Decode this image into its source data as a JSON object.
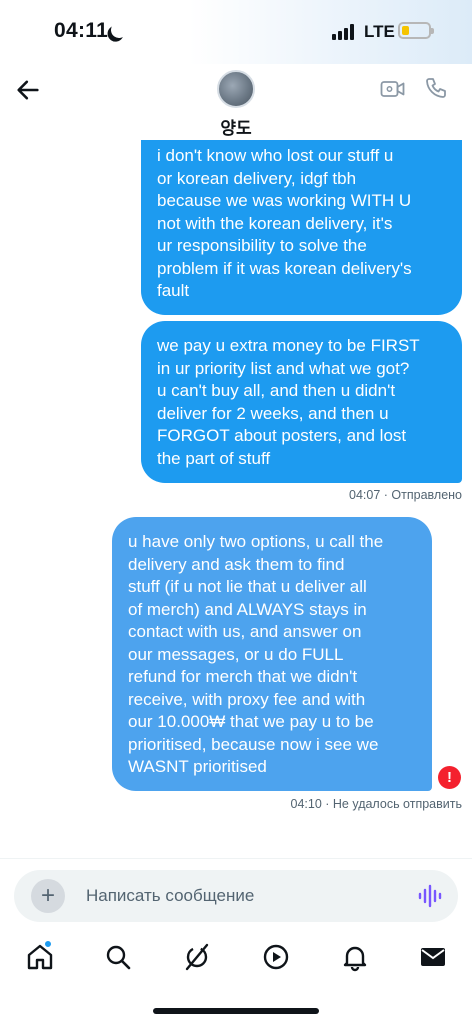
{
  "status_bar": {
    "time": "04:11",
    "network": "LTE",
    "battery_level": 0.2,
    "battery_color": "#f5c400"
  },
  "header": {
    "contact_name": "양도",
    "back_icon": "arrow-left-icon",
    "video_icon": "video-call-icon",
    "phone_icon": "phone-icon"
  },
  "messages": [
    {
      "text": "i don't know who lost our stuff u\nor korean delivery, idgf tbh\nbecause we was working WITH U\nnot with the korean delivery, it's\nur responsibility to solve the\nproblem if it was korean delivery's\nfault"
    },
    {
      "text": "we pay u extra money to be FIRST\nin ur priority list and what we got?\nu can't buy all, and then u didn't\ndeliver for 2 weeks, and then u\nFORGOT about posters, and lost\nthe part of stuff",
      "meta": "04:07 · Отправлено"
    },
    {
      "text": "u have only two options, u call the\ndelivery and ask them to find\nstuff (if u not lie that u deliver all\nof merch) and ALWAYS stays in\ncontact with us, and answer on\nour messages, or u do FULL\nrefund for merch that we didn't\nreceive, with proxy fee and with\nour 10.000₩ that we pay u to be\nprioritised, because now i see we\nWASNT prioritised",
      "meta": "04:10 · Не удалось отправить",
      "status": "failed"
    }
  ],
  "composer": {
    "placeholder": "Написать сообщение",
    "add_icon": "plus-icon",
    "voice_icon": "voice-waveform-icon"
  },
  "tabbar": {
    "items": [
      "home",
      "search",
      "grok",
      "video",
      "notifications",
      "messages"
    ],
    "active": "messages",
    "home_has_badge": true
  },
  "colors": {
    "accent": "#1d9bf0",
    "failed_bubble": "#4da3ee",
    "error": "#f4212e",
    "voice": "#7856ff"
  }
}
